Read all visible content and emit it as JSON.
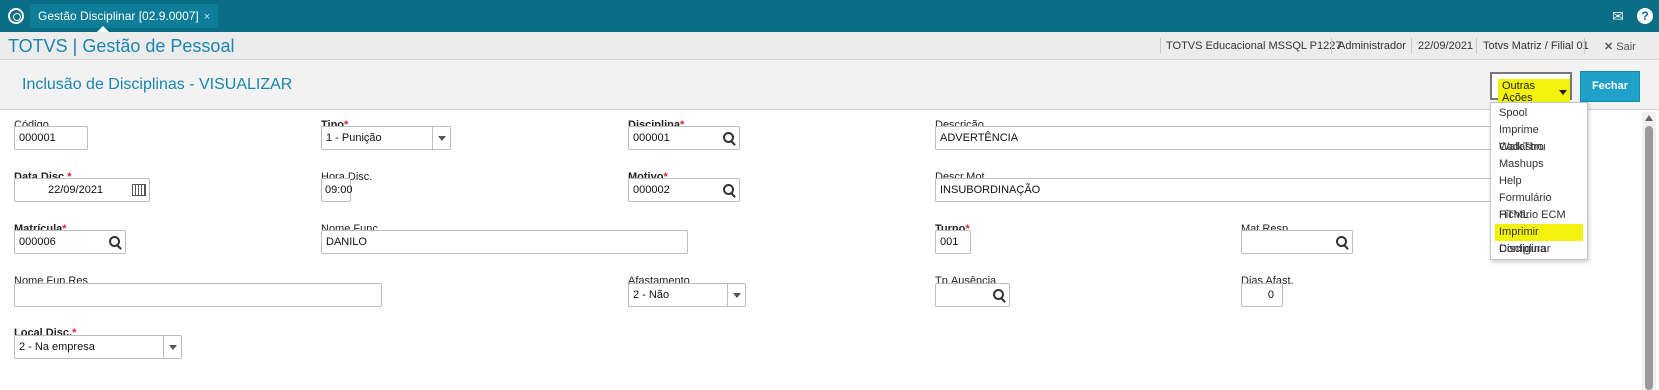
{
  "topbar": {
    "tab_label": "Gestão Disciplinar [02.9.0007]",
    "tab_close": "×"
  },
  "header": {
    "brand": "TOTVS | Gestão de Pessoal",
    "environment": "TOTVS Educacional MSSQL P1227",
    "user": "Administrador",
    "date": "22/09/2021",
    "branch": "Totvs Matriz / Filial 01",
    "exit_label": "Sair"
  },
  "page": {
    "title": "Inclusão de Disciplinas - VISUALIZAR"
  },
  "actions": {
    "outras_acoes": "Outras Ações",
    "fechar": "Fechar"
  },
  "menu": {
    "items": [
      "Spool",
      "Imprime Cadastro",
      "WalkThru",
      "Mashups",
      "Help",
      "Formulário HTML",
      "Fichário ECM",
      "Imprimir Disciplina",
      "Configurar"
    ],
    "highlighted": "Imprimir Disciplina"
  },
  "fields": {
    "codigo": {
      "label": "Código",
      "value": "000001"
    },
    "tipo": {
      "label": "Tipo",
      "value": "1 - Punição"
    },
    "disciplina": {
      "label": "Disciplina",
      "value": "000001"
    },
    "descricao": {
      "label": "Descrição",
      "value": "ADVERTÊNCIA"
    },
    "data_disc": {
      "label": "Data Disc.",
      "value": "22/09/2021"
    },
    "hora_disc": {
      "label": "Hora Disc.",
      "value": "09:00"
    },
    "motivo": {
      "label": "Motivo",
      "value": "000002"
    },
    "descr_mot": {
      "label": "Descr.Mot.",
      "value": "INSUBORDINAÇÃO"
    },
    "matricula": {
      "label": "Matrícula",
      "value": "000006"
    },
    "nome_func": {
      "label": "Nome Func.",
      "value": "DANILO"
    },
    "turno": {
      "label": "Turno",
      "value": "001"
    },
    "mat_resp": {
      "label": "Mat.Resp.",
      "value": ""
    },
    "nome_fun_res": {
      "label": "Nome Fun.Res",
      "value": ""
    },
    "afastamento": {
      "label": "Afastamento",
      "value": "2 - Não"
    },
    "tp_ausencia": {
      "label": "Tp.Ausência",
      "value": ""
    },
    "dias_afast": {
      "label": "Dias Afast.",
      "value": "0"
    },
    "local_disc": {
      "label": "Local Disc.",
      "value": "2 - Na empresa"
    }
  },
  "required_mark": "*",
  "colors": {
    "topbar": "#0b6e87",
    "accent": "#1a86b0",
    "button": "#1ea2c8",
    "highlight": "#f2f20a",
    "required": "#d9232d"
  }
}
